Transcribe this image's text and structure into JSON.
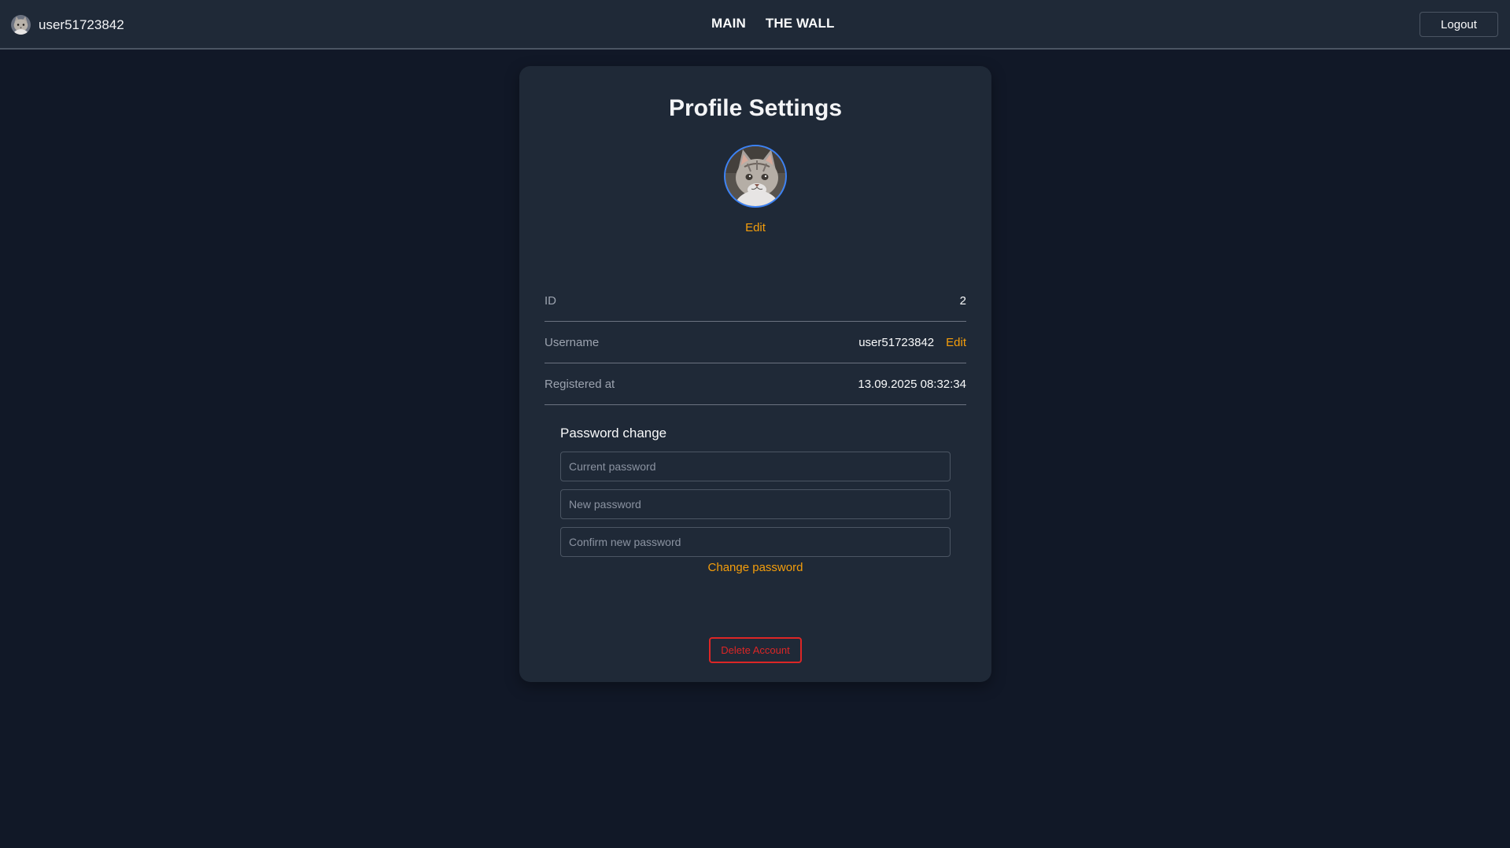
{
  "header": {
    "username": "user51723842",
    "avatar_icon": "cat-avatar-icon",
    "nav": [
      {
        "label": "MAIN"
      },
      {
        "label": "THE WALL"
      }
    ],
    "logout_label": "Logout"
  },
  "profile": {
    "title": "Profile Settings",
    "avatar_edit_label": "Edit",
    "rows": [
      {
        "label": "ID",
        "value": "2"
      },
      {
        "label": "Username",
        "value": "user51723842",
        "edit_label": "Edit"
      },
      {
        "label": "Registered at",
        "value": "13.09.2025 08:32:34"
      }
    ]
  },
  "password": {
    "title": "Password change",
    "current_placeholder": "Current password",
    "new_placeholder": "New password",
    "confirm_placeholder": "Confirm new password",
    "submit_label": "Change password"
  },
  "danger": {
    "delete_label": "Delete Account"
  },
  "colors": {
    "background": "#111827",
    "surface": "#1f2937",
    "accent": "#f59e0b",
    "danger": "#dc2626",
    "avatar_ring": "#3b82f6"
  }
}
